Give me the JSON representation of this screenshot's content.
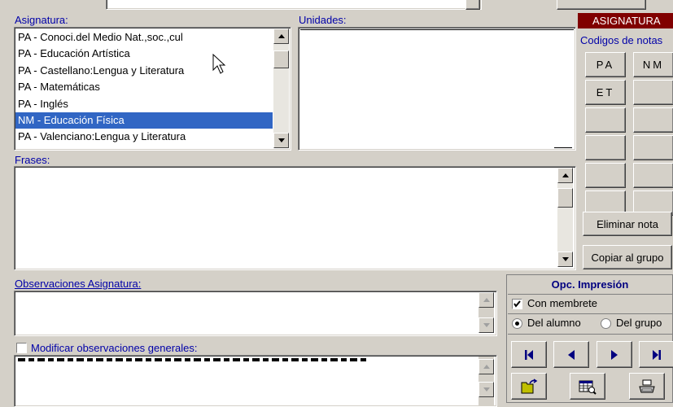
{
  "labels": {
    "asignatura": "Asignatura:",
    "unidades": "Unidades:",
    "frases": "Frases:",
    "observaciones": "Observaciones Asignatura:",
    "modificar": "Modificar observaciones generales:"
  },
  "asignatura_list": [
    "PA - Conoci.del Medio Nat.,soc.,cul",
    "PA - Educación Artística",
    "PA - Castellano:Lengua y Literatura",
    "PA - Matemáticas",
    "PA - Inglés",
    "NM - Educación Física",
    "PA - Valenciano:Lengua y Literatura"
  ],
  "selected_index": 5,
  "right_panel": {
    "header": "ASIGNATURA",
    "codigos_label": "Codigos de notas",
    "codes": [
      "PA",
      "NM",
      "ET",
      "",
      "",
      "",
      "",
      "",
      "",
      "",
      "",
      ""
    ],
    "eliminar": "Eliminar nota",
    "copiar": "Copiar al grupo"
  },
  "print": {
    "title": "Opc. Impresión",
    "membrete": "Con membrete",
    "membrete_checked": true,
    "del_alumno": "Del alumno",
    "del_grupo": "Del grupo",
    "selected_option": "Del alumno"
  },
  "modificar_checked": false,
  "colors": {
    "label_blue": "#0000a8",
    "selection": "#3166c4",
    "header_bg": "#800000"
  }
}
